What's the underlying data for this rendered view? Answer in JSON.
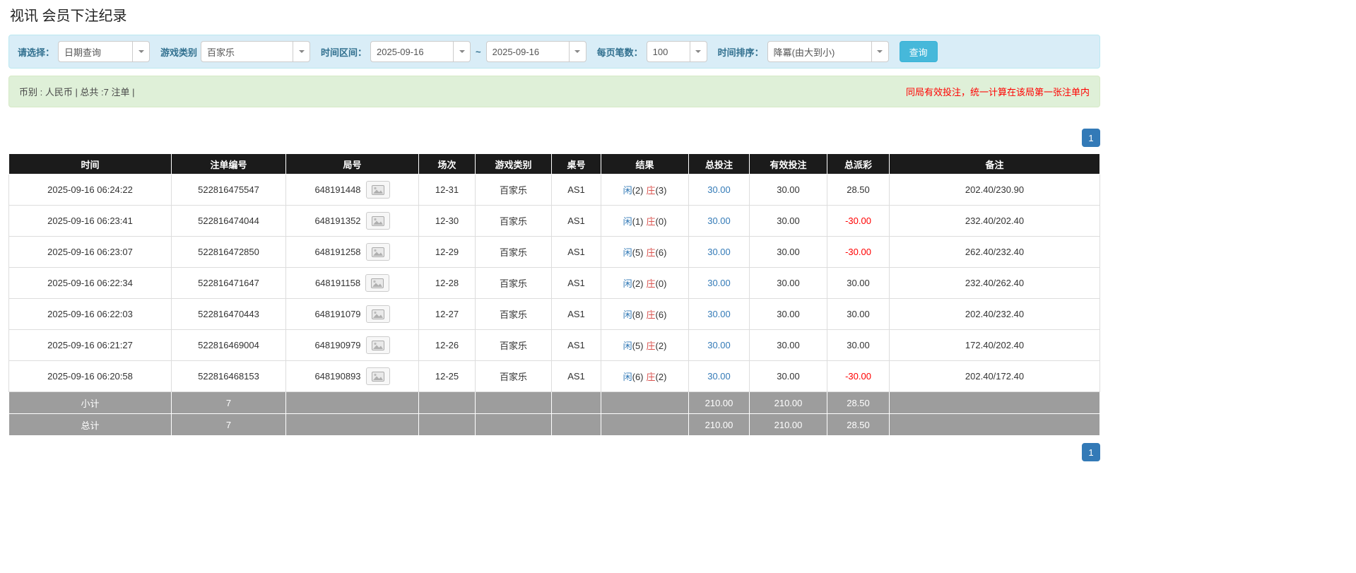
{
  "page": {
    "title": "视讯 会员下注纪录"
  },
  "filter_bar": {
    "select_label": "请选择：",
    "select_value": "日期查询",
    "game_label": "游戏类别",
    "game_value": "百家乐",
    "range_label": "时间区间：",
    "date_from": "2025-09-16",
    "range_separator": "~",
    "date_to": "2025-09-16",
    "page_size_label": "每页笔数：",
    "page_size_value": "100",
    "sort_label": "时间排序：",
    "sort_value": "降冪(由大到小)",
    "search_label": "查询"
  },
  "summary_bar": {
    "left_text": "币别 : 人民币 | 总共 :7 注单 |",
    "right_text": "同局有效投注，统一计算在该局第一张注单内"
  },
  "pagination": {
    "current_page": "1"
  },
  "icons": {
    "dropdown": "caret-down-icon",
    "round_preview": "picture-icon"
  },
  "colors": {
    "filter_bg": "#d9edf7",
    "summary_bg": "#dff0d8",
    "header_bg": "#1b1b1b",
    "footer_bg": "#9d9d9d",
    "link_blue": "#337ab7",
    "player_blue": "#337ab7",
    "banker_red": "#d9534f",
    "negative_red": "#ff0000",
    "search_button_blue": "#46b8da",
    "pagination_blue": "#337ab7"
  },
  "table": {
    "headers": [
      "时间",
      "注单编号",
      "局号",
      "场次",
      "游戏类别",
      "桌号",
      "结果",
      "总投注",
      "有效投注",
      "总派彩",
      "备注"
    ],
    "rows": [
      {
        "time": "2025-09-16 06:24:22",
        "bet_id": "522816475547",
        "round_id": "648191448",
        "session": "12-31",
        "game": "百家乐",
        "table_no": "AS1",
        "player": "闲",
        "player_score": "(2)",
        "banker": "庄",
        "banker_score": "(3)",
        "total_bet": "30.00",
        "valid_bet": "30.00",
        "payout": "28.50",
        "remark": "202.40/230.90"
      },
      {
        "time": "2025-09-16 06:23:41",
        "bet_id": "522816474044",
        "round_id": "648191352",
        "session": "12-30",
        "game": "百家乐",
        "table_no": "AS1",
        "player": "闲",
        "player_score": "(1)",
        "banker": "庄",
        "banker_score": "(0)",
        "total_bet": "30.00",
        "valid_bet": "30.00",
        "payout": "-30.00",
        "remark": "232.40/202.40"
      },
      {
        "time": "2025-09-16 06:23:07",
        "bet_id": "522816472850",
        "round_id": "648191258",
        "session": "12-29",
        "game": "百家乐",
        "table_no": "AS1",
        "player": "闲",
        "player_score": "(5)",
        "banker": "庄",
        "banker_score": "(6)",
        "total_bet": "30.00",
        "valid_bet": "30.00",
        "payout": "-30.00",
        "remark": "262.40/232.40"
      },
      {
        "time": "2025-09-16 06:22:34",
        "bet_id": "522816471647",
        "round_id": "648191158",
        "session": "12-28",
        "game": "百家乐",
        "table_no": "AS1",
        "player": "闲",
        "player_score": "(2)",
        "banker": "庄",
        "banker_score": "(0)",
        "total_bet": "30.00",
        "valid_bet": "30.00",
        "payout": "30.00",
        "remark": "232.40/262.40"
      },
      {
        "time": "2025-09-16 06:22:03",
        "bet_id": "522816470443",
        "round_id": "648191079",
        "session": "12-27",
        "game": "百家乐",
        "table_no": "AS1",
        "player": "闲",
        "player_score": "(8)",
        "banker": "庄",
        "banker_score": "(6)",
        "total_bet": "30.00",
        "valid_bet": "30.00",
        "payout": "30.00",
        "remark": "202.40/232.40"
      },
      {
        "time": "2025-09-16 06:21:27",
        "bet_id": "522816469004",
        "round_id": "648190979",
        "session": "12-26",
        "game": "百家乐",
        "table_no": "AS1",
        "player": "闲",
        "player_score": "(5)",
        "banker": "庄",
        "banker_score": "(2)",
        "total_bet": "30.00",
        "valid_bet": "30.00",
        "payout": "30.00",
        "remark": "172.40/202.40"
      },
      {
        "time": "2025-09-16 06:20:58",
        "bet_id": "522816468153",
        "round_id": "648190893",
        "session": "12-25",
        "game": "百家乐",
        "table_no": "AS1",
        "player": "闲",
        "player_score": "(6)",
        "banker": "庄",
        "banker_score": "(2)",
        "total_bet": "30.00",
        "valid_bet": "30.00",
        "payout": "-30.00",
        "remark": "202.40/172.40"
      }
    ],
    "subtotal": {
      "label": "小计",
      "count": "7",
      "total_bet": "210.00",
      "valid_bet": "210.00",
      "payout": "28.50"
    },
    "grand_total": {
      "label": "总计",
      "count": "7",
      "total_bet": "210.00",
      "valid_bet": "210.00",
      "payout": "28.50"
    }
  }
}
